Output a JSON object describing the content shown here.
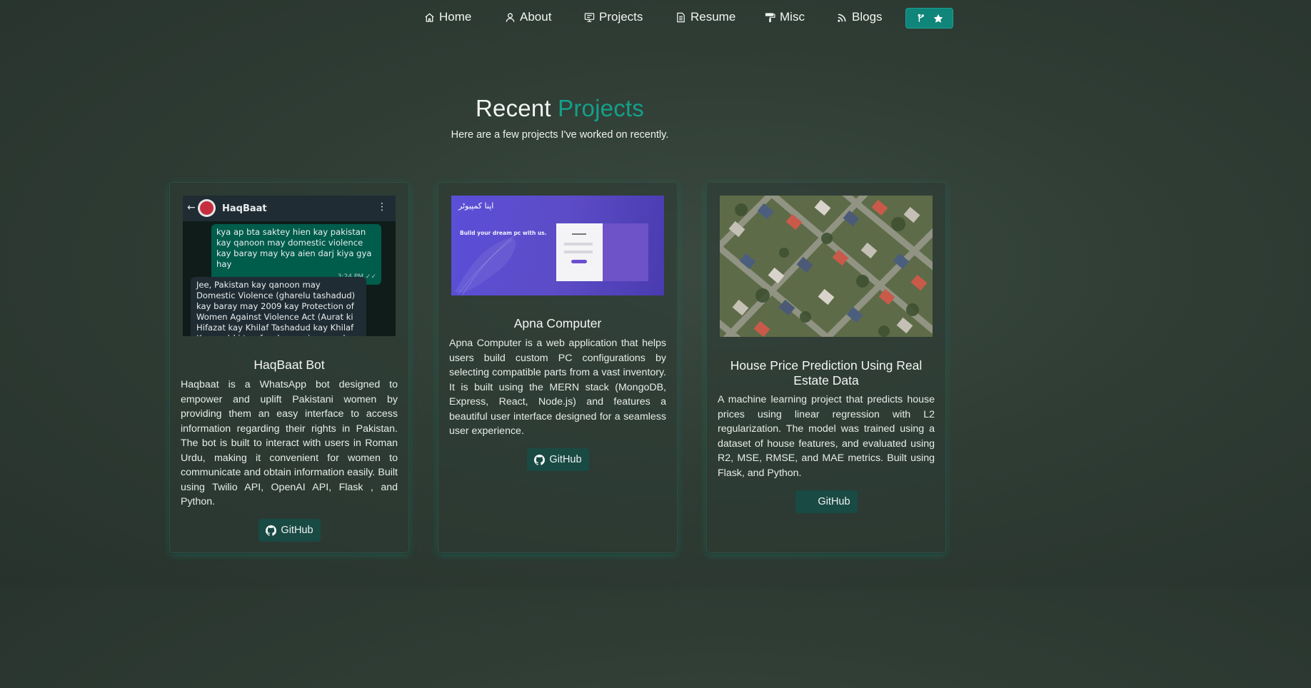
{
  "nav": {
    "items": [
      {
        "label": "Home",
        "icon": "home-icon"
      },
      {
        "label": "About",
        "icon": "user-icon"
      },
      {
        "label": "Projects",
        "icon": "projects-icon"
      },
      {
        "label": "Resume",
        "icon": "document-icon"
      },
      {
        "label": "Misc",
        "icon": "paint-roller-icon"
      },
      {
        "label": "Blogs",
        "icon": "feed-icon"
      }
    ],
    "star_button": {
      "icons": [
        "fork-icon",
        "star-icon"
      ]
    }
  },
  "header": {
    "title_part1": "Recent",
    "title_part2": "Projects",
    "subtitle": "Here are a few projects I've worked on recently."
  },
  "projects": [
    {
      "title": "HaqBaat Bot",
      "description": "Haqbaat is a WhatsApp bot designed to empower and uplift Pakistani women by providing them an easy interface to access information regarding their rights in Pakistan. The bot is built to interact with users in Roman Urdu, making it convenient for women to communicate and obtain information easily. Built using Twilio API, OpenAI API, Flask , and Python.",
      "button_label": "GitHub",
      "image": {
        "chat_name": "HaqBaat",
        "outgoing": "kya ap bta saktey hien kay pakistan kay qanoon may domestic violence kay baray may kya aien darj kiya gya hay",
        "outgoing_time": "3:24 PM",
        "incoming": "Jee, Pakistan kay qanoon may Domestic Violence (gharelu tashadud) kay baray may 2009 kay Protection of Women Against Violence Act (Aurat ki Hifazat kay Khilaf Tashadud kay Khilaf Kanoon) ki taraf se kanooni aqsam kay dariay"
      }
    },
    {
      "title": "Apna Computer",
      "description": "Apna Computer is a web application that helps users build custom PC configurations by selecting compatible parts from a vast inventory. It is built using the MERN stack (MongoDB, Express, React, Node.js) and features a beautiful user interface designed for a seamless user experience.",
      "button_label": "GitHub",
      "image": {
        "logo": "اپنا کمپیوٹر",
        "tagline": "Build your dream pc with us."
      }
    },
    {
      "title": "House Price Prediction Using Real Estate Data",
      "description": "A machine learning project that predicts house prices using linear regression with L2 regularization. The model was trained using a dataset of house features, and evaluated using R2, MSE, RMSE, and MAE metrics. Built using Flask, and Python.",
      "button_label": "GitHub"
    }
  ],
  "colors": {
    "accent": "#14a08a",
    "button_bg": "#1a4a44",
    "star_button_bg": "#10857a"
  }
}
